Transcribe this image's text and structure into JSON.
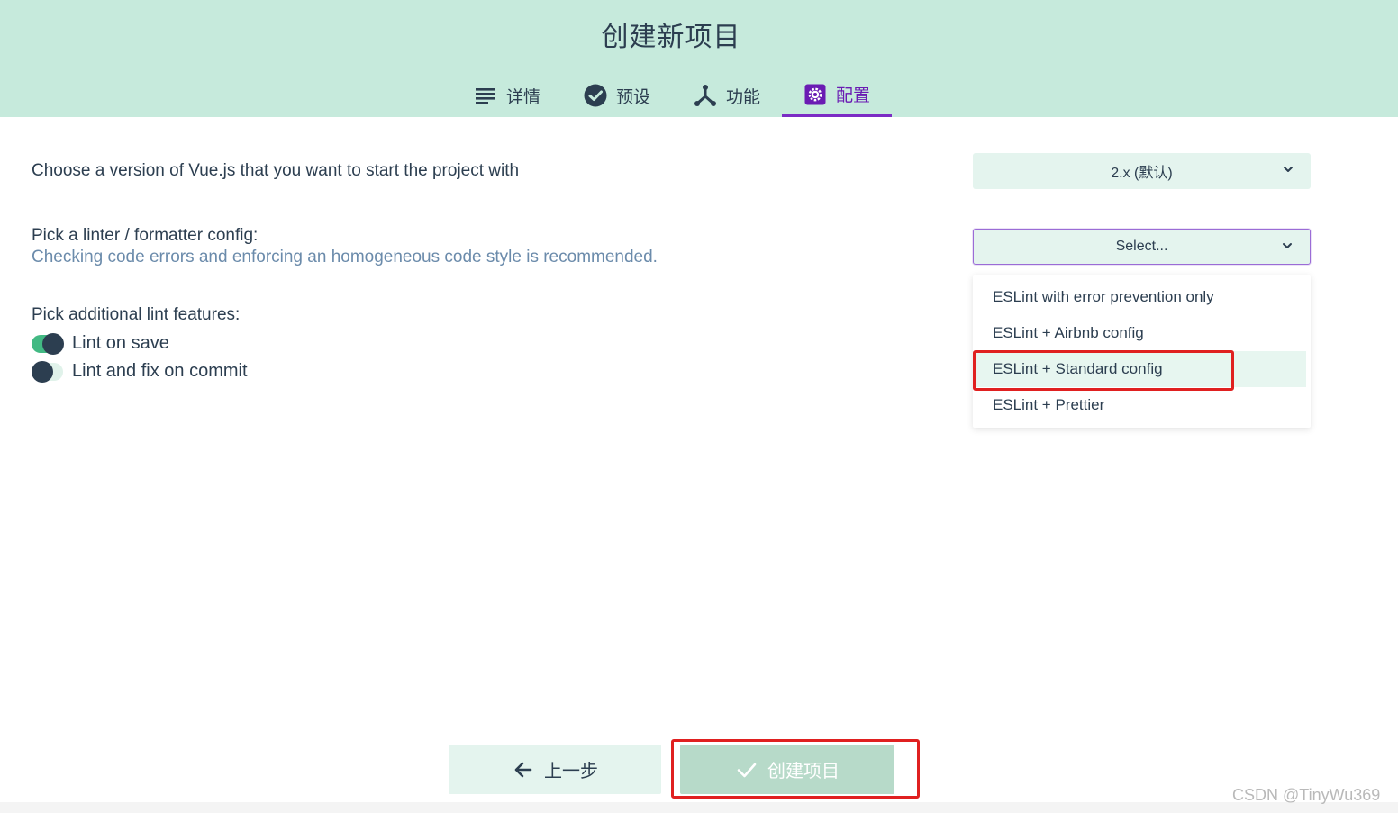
{
  "header": {
    "title": "创建新项目",
    "tabs": [
      {
        "label": "详情",
        "icon": "list-icon"
      },
      {
        "label": "预设",
        "icon": "check-circle-icon"
      },
      {
        "label": "功能",
        "icon": "fork-icon"
      },
      {
        "label": "配置",
        "icon": "gear-icon",
        "active": true
      }
    ]
  },
  "form": {
    "vue_version": {
      "label": "Choose a version of Vue.js that you want to start the project with",
      "value": "2.x (默认)"
    },
    "linter": {
      "label": "Pick a linter / formatter config:",
      "description": "Checking code errors and enforcing an homogeneous code style is recommended.",
      "placeholder": "Select...",
      "options": [
        "ESLint with error prevention only",
        "ESLint + Airbnb config",
        "ESLint + Standard config",
        "ESLint + Prettier"
      ],
      "highlighted_option": "ESLint + Standard config"
    },
    "lint_features": {
      "label": "Pick additional lint features:",
      "items": [
        {
          "label": "Lint on save",
          "enabled": true
        },
        {
          "label": "Lint and fix on commit",
          "enabled": false
        }
      ]
    }
  },
  "footer": {
    "back_label": "上一步",
    "create_label": "创建项目"
  },
  "watermark": "CSDN @TinyWu369",
  "colors": {
    "header_bg": "#c6eadc",
    "accent_purple": "#7b2cc4",
    "toggle_on": "#42b983",
    "annotation_red": "#e02020",
    "description_text": "#6b8bab"
  }
}
